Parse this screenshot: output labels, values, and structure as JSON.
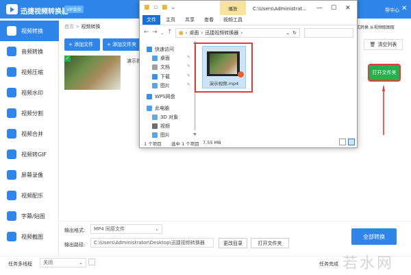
{
  "app": {
    "title": "迅捷视频转换器",
    "badge": "VIP会员",
    "help": "帮中心",
    "breadcrumb_home": "首页",
    "breadcrumb_sep": " > ",
    "breadcrumb_current": "视频转换",
    "add_file": "+ 添加文件",
    "add_folder": "+ 添加文件夹",
    "item_name": "演示视",
    "right_hint": "式转换 从视频取图取",
    "clear_list": "清空列表",
    "open_folder_green": "打开文件夹",
    "accent_color": "#2f86e8",
    "green_color": "#22b14c",
    "sidebar": [
      {
        "label": "视频转换",
        "icon": "video-convert-icon"
      },
      {
        "label": "音频转换",
        "icon": "audio-convert-icon"
      },
      {
        "label": "视频压缩",
        "icon": "video-compress-icon"
      },
      {
        "label": "视频水印",
        "icon": "video-watermark-icon"
      },
      {
        "label": "视频分割",
        "icon": "video-split-icon"
      },
      {
        "label": "视频合并",
        "icon": "video-merge-icon"
      },
      {
        "label": "视频转GIF",
        "icon": "video-gif-icon"
      },
      {
        "label": "屏幕录像",
        "icon": "screen-record-icon"
      },
      {
        "label": "视频配乐",
        "icon": "video-music-icon"
      },
      {
        "label": "字幕/贴图",
        "icon": "subtitle-icon"
      },
      {
        "label": "视频截图",
        "icon": "video-screenshot-icon"
      }
    ],
    "output_format_label": "输出格式:",
    "output_format_value": "MP4  同原文件",
    "output_path_label": "输出路径:",
    "output_path_value": "C:\\Users\\Administrator\\Desktop\\迅捷视频转换器",
    "change_dir": "更改目录",
    "open_folder": "打开文件夹",
    "convert_all": "全部转换",
    "task_threads_label": "任务多线程",
    "task_threads_value": "关闭",
    "task_status": "任务完成",
    "watermark": "若水网"
  },
  "explorer": {
    "manage_tab": "播放",
    "title_path": "C:\\Users\\Administrat...",
    "tabs": [
      "文件",
      "主页",
      "共享",
      "查看",
      "视频工具"
    ],
    "address_parts": [
      "桌面",
      "迅捷视频转换器"
    ],
    "nav": [
      {
        "label": "快速访问",
        "icon": "star-icon",
        "color": "#3b8fe0",
        "pinned": false,
        "indent": 0
      },
      {
        "label": "桌面",
        "icon": "desktop-icon",
        "color": "#4aa3e8",
        "pinned": true,
        "indent": 1
      },
      {
        "label": "文档",
        "icon": "document-icon",
        "color": "#a0a0a0",
        "pinned": true,
        "indent": 1
      },
      {
        "label": "下载",
        "icon": "download-icon",
        "color": "#3b8fe0",
        "pinned": true,
        "indent": 1
      },
      {
        "label": "图片",
        "icon": "picture-icon",
        "color": "#5aa7e0",
        "pinned": true,
        "indent": 1
      },
      {
        "label": "WPS网盘",
        "icon": "cloud-icon",
        "color": "#3b8fe0",
        "pinned": false,
        "indent": 0
      },
      {
        "label": "此电脑",
        "icon": "computer-icon",
        "color": "#4aa3e8",
        "pinned": false,
        "indent": 0
      },
      {
        "label": "3D 对象",
        "icon": "cube-icon",
        "color": "#6aa8d8",
        "pinned": false,
        "indent": 1
      },
      {
        "label": "视频",
        "icon": "video-folder-icon",
        "color": "#6d6d6d",
        "pinned": false,
        "indent": 1
      },
      {
        "label": "图片",
        "icon": "picture-icon",
        "color": "#5aa7e0",
        "pinned": false,
        "indent": 1
      }
    ],
    "file_name": "演示视频.mp4",
    "status_count": "1 个项目",
    "status_selected": "选中 1 个项目",
    "status_size": "7.55 MB"
  }
}
